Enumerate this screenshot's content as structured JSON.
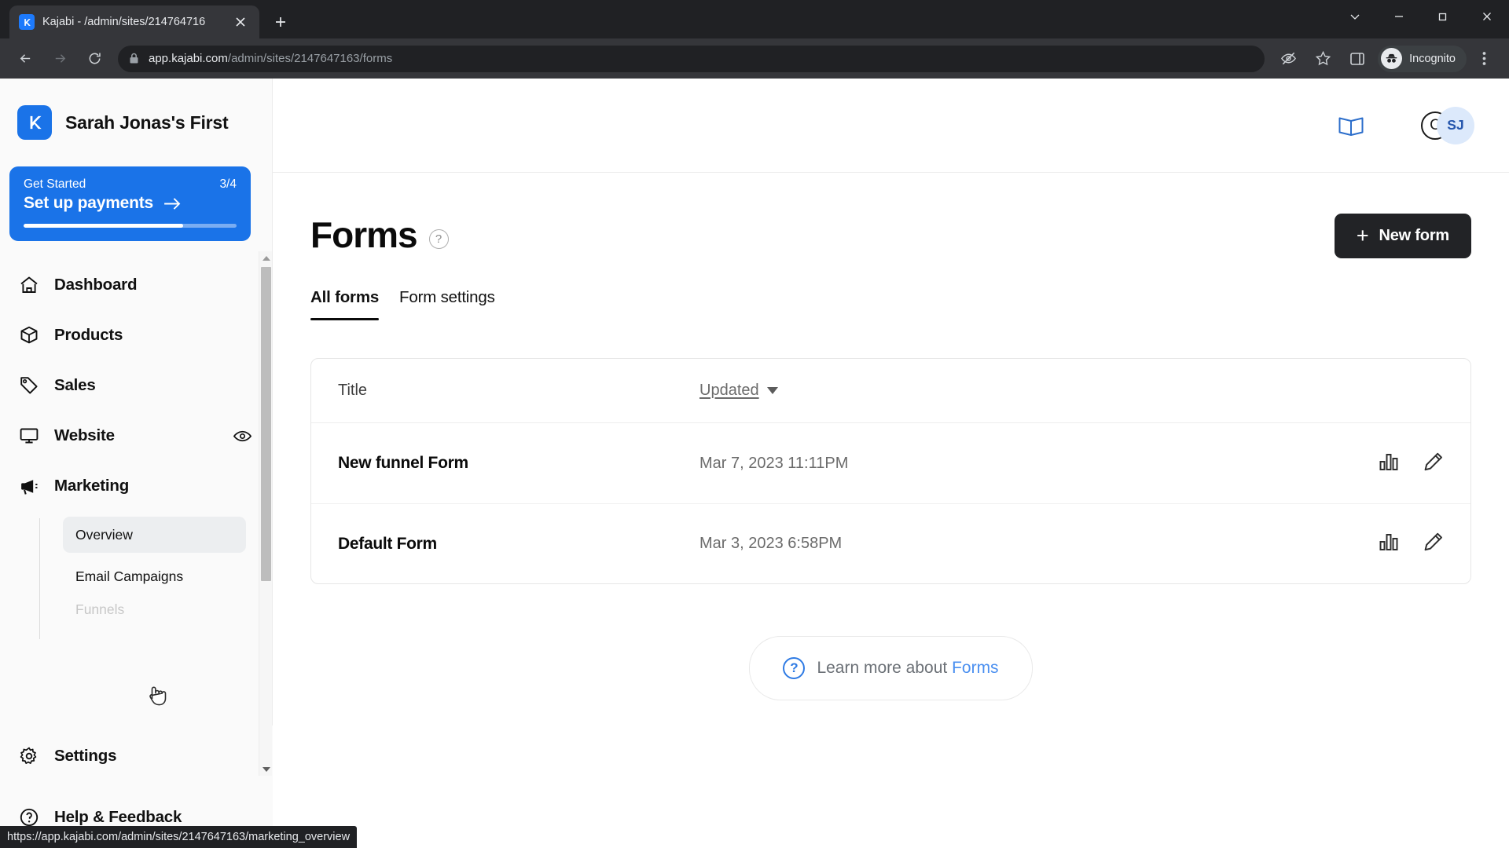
{
  "browser": {
    "tab": {
      "title": "Kajabi - /admin/sites/214764716",
      "favicon": "kajabi-logo-icon",
      "close_icon": "close-icon"
    },
    "new_tab_icon": "plus-icon",
    "window_controls": {
      "minimize_all": "chevron-down-icon",
      "minimize": "minimize-icon",
      "maximize": "maximize-icon",
      "close": "close-icon"
    },
    "toolbar": {
      "back_icon": "back-arrow-icon",
      "forward_icon": "forward-arrow-icon",
      "reload_icon": "reload-icon",
      "lock_icon": "lock-icon",
      "url_domain": "app.kajabi.com",
      "url_path": "/admin/sites/2147647163/forms",
      "tracking_icon": "eye-off-icon",
      "bookmark_icon": "star-icon",
      "sidepanel_icon": "side-panel-icon",
      "profile_icon": "incognito-icon",
      "profile_label": "Incognito",
      "menu_icon": "kebab-menu-icon"
    },
    "status_url": "https://app.kajabi.com/admin/sites/2147647163/marketing_overview"
  },
  "sidebar": {
    "brand": {
      "name": "Sarah Jonas's First",
      "logo_icon": "kajabi-logo-icon"
    },
    "get_started": {
      "label": "Get Started",
      "progress_text": "3/4",
      "cta": "Set up payments",
      "arrow_icon": "arrow-right-icon",
      "progress_percent": 75
    },
    "items": [
      {
        "label": "Dashboard",
        "icon": "home-icon"
      },
      {
        "label": "Products",
        "icon": "box-icon"
      },
      {
        "label": "Sales",
        "icon": "tag-icon"
      },
      {
        "label": "Website",
        "icon": "monitor-icon",
        "trailing_icon": "eye-icon"
      },
      {
        "label": "Marketing",
        "icon": "megaphone-icon"
      }
    ],
    "submenu": [
      {
        "label": "Overview",
        "active": true
      },
      {
        "label": "Email Campaigns",
        "active": false
      },
      {
        "label": "Funnels",
        "active": false
      }
    ],
    "bottom_items": [
      {
        "label": "Settings",
        "icon": "gear-icon"
      },
      {
        "label": "Help & Feedback",
        "icon": "question-circle-icon"
      }
    ],
    "scrollbar": {
      "up_icon": "scroll-up-arrow",
      "down_icon": "scroll-down-arrow"
    }
  },
  "header": {
    "book_icon": "open-book-icon",
    "avatar_secondary": "C",
    "avatar_primary": "SJ"
  },
  "main": {
    "title": "Forms",
    "help_icon_label": "?",
    "new_form_button": "New form",
    "new_form_plus": "+",
    "tabs": [
      {
        "label": "All forms",
        "active": true
      },
      {
        "label": "Form settings",
        "active": false
      }
    ],
    "table": {
      "columns": {
        "title": "Title",
        "updated": "Updated"
      },
      "sort_indicator": "caret-down-icon",
      "rows": [
        {
          "title": "New funnel Form",
          "updated": "Mar 7, 2023 11:11PM",
          "actions": [
            "analytics-icon",
            "edit-pencil-icon"
          ]
        },
        {
          "title": "Default Form",
          "updated": "Mar 3, 2023 6:58PM",
          "actions": [
            "analytics-icon",
            "edit-pencil-icon"
          ]
        }
      ]
    },
    "learn_more": {
      "icon": "question-circle-icon",
      "prefix": "Learn more about",
      "link": "Forms"
    }
  },
  "colors": {
    "accent_blue": "#1a73e8",
    "link_blue": "#4a8ff0",
    "button_dark": "#222326",
    "avatar_bg": "#dce9fb"
  }
}
